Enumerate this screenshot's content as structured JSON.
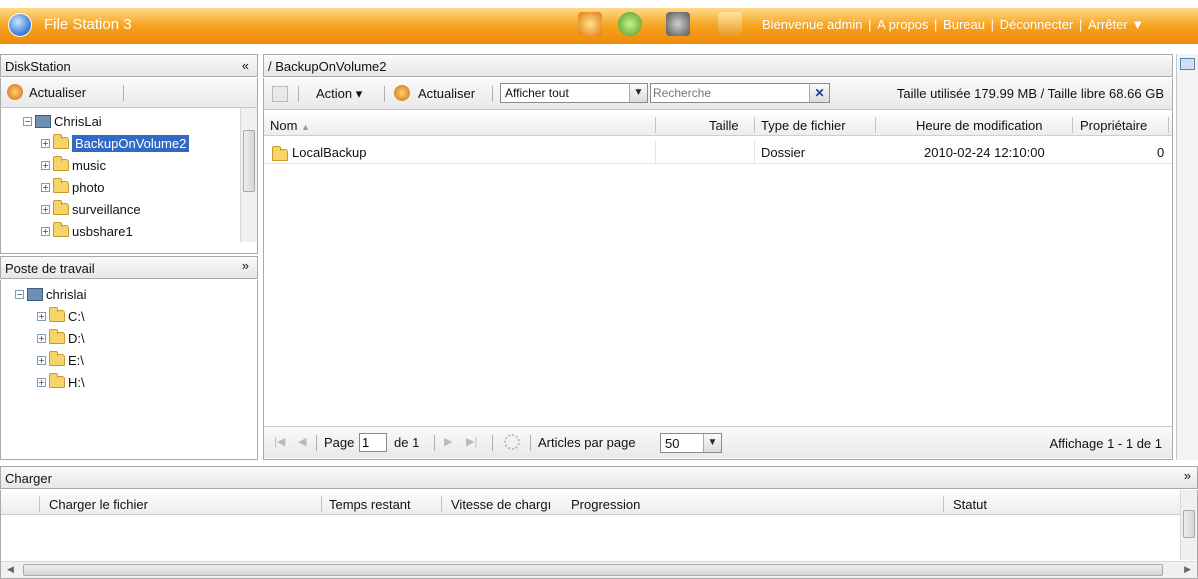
{
  "app": {
    "title": "File Station 3"
  },
  "topbar": {
    "links": [
      "Bienvenue admin",
      "A propos",
      "Bureau",
      "Déconnecter",
      "Arrêter ▼"
    ]
  },
  "left": {
    "diskstation": {
      "title": "DiskStation",
      "collapse_glyph": "«",
      "refresh_label": "Actualiser",
      "root": "ChrisLai",
      "items": [
        "BackupOnVolume2",
        "music",
        "photo",
        "surveillance",
        "usbshare1"
      ],
      "selected": "BackupOnVolume2"
    },
    "workstation": {
      "title": "Poste de travail",
      "collapse_glyph": "»",
      "root": "chrislai",
      "drives": [
        "C:\\",
        "D:\\",
        "E:\\",
        "H:\\"
      ]
    }
  },
  "main": {
    "path": "/ BackupOnVolume2",
    "toolbar": {
      "action_label": "Action ▾",
      "refresh_label": "Actualiser",
      "filter_value": "Afficher tout",
      "search_placeholder": "Recherche",
      "usage": "Taille utilisée 179.99 MB / Taille libre 68.66 GB"
    },
    "columns": [
      "Nom",
      "Taille",
      "Type de fichier",
      "Heure de modification",
      "Propriétaire"
    ],
    "rows": [
      {
        "name": "LocalBackup",
        "size": "",
        "type": "Dossier",
        "modified": "2010-02-24 12:10:00",
        "owner": "0"
      }
    ],
    "pager": {
      "page_label": "Page",
      "page_value": "1",
      "of_label": "de 1",
      "per_page_label": "Articles par page",
      "per_page_value": "50",
      "display": "Affichage 1 - 1 de 1"
    }
  },
  "upload": {
    "title": "Charger",
    "columns": [
      "Charger le fichier",
      "Temps restant",
      "Vitesse de chargı",
      "Progression",
      "Statut"
    ]
  },
  "colors": {
    "accent": "#f08a0a",
    "selection": "#316ac5"
  }
}
